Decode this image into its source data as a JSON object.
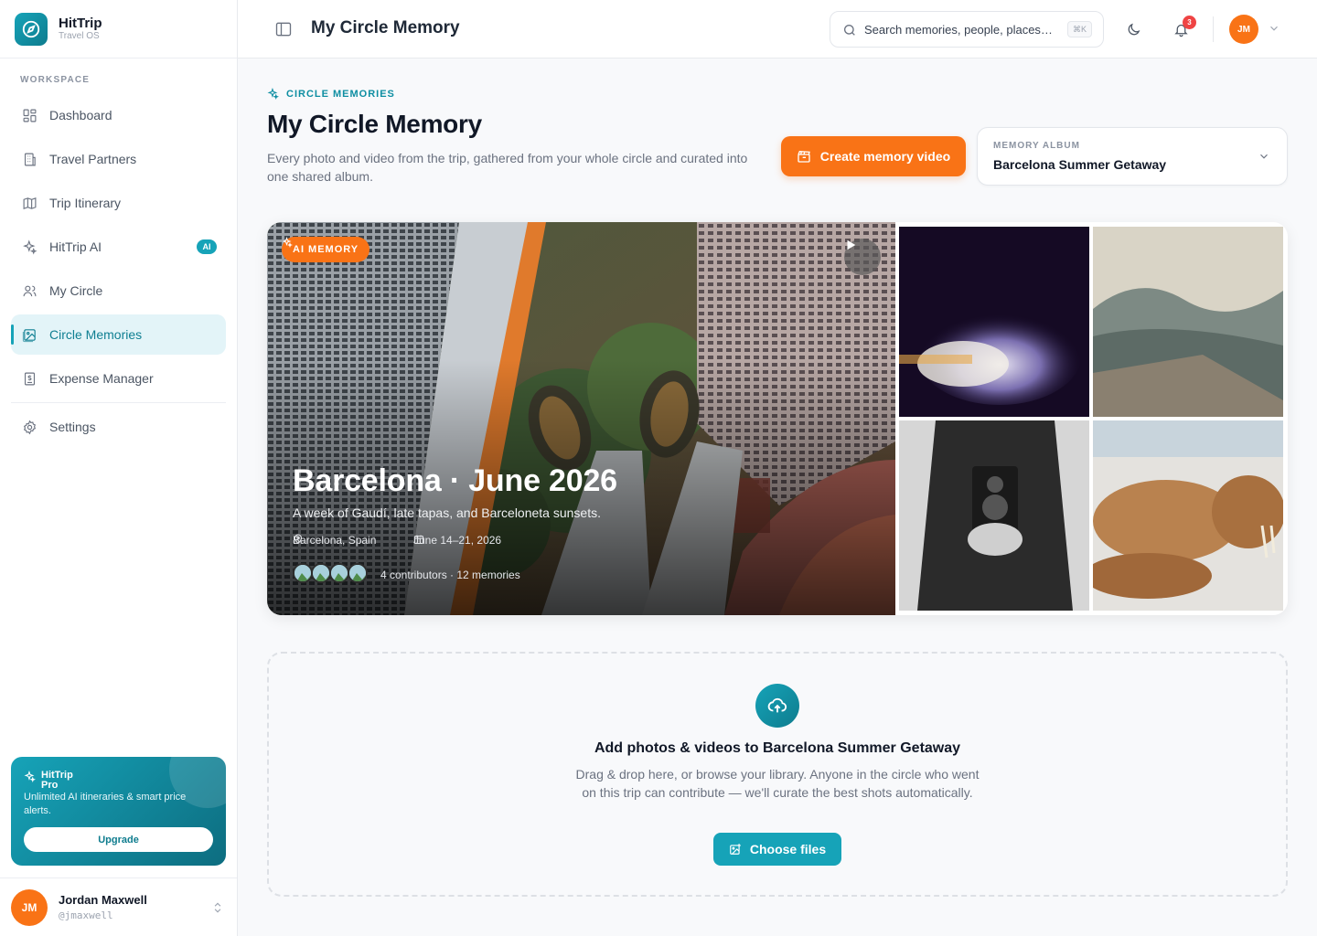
{
  "brand": {
    "name": "HitTrip",
    "tagline": "Travel OS"
  },
  "sidebar": {
    "section_label": "WORKSPACE",
    "items": [
      {
        "label": "Dashboard",
        "icon": "grid-icon"
      },
      {
        "label": "Travel Partners",
        "icon": "building-icon"
      },
      {
        "label": "Trip Itinerary",
        "icon": "map-icon"
      },
      {
        "label": "HitTrip AI",
        "icon": "sparkles-icon",
        "badge": "AI"
      },
      {
        "label": "My Circle",
        "icon": "users-icon"
      },
      {
        "label": "Circle Memories",
        "icon": "images-icon",
        "active": true
      },
      {
        "label": "Expense Manager",
        "icon": "receipt-icon"
      }
    ],
    "settings_label": "Settings",
    "promo": {
      "title": "HitTrip Pro",
      "description": "Unlimited AI itineraries & smart price alerts.",
      "button": "Upgrade"
    },
    "user": {
      "initials": "JM",
      "name": "Jordan Maxwell",
      "handle": "@jmaxwell"
    }
  },
  "topbar": {
    "title": "My Circle Memory",
    "search_placeholder": "Search memories, people, places…",
    "search_shortcut": "⌘K",
    "notifications_count": "3",
    "avatar_initials": "JM"
  },
  "page": {
    "eyebrow": "CIRCLE MEMORIES",
    "title": "My Circle Memory",
    "description": "Every photo and video from the trip, gathered from your whole circle and curated into one shared album.",
    "cta": "Create memory video",
    "album_label": "MEMORY ALBUM",
    "album_value": "Barcelona Summer Getaway"
  },
  "hero": {
    "badge": "AI MEMORY",
    "title": "Barcelona · June 2026",
    "subtitle": "A week of Gaudí, late tapas, and Barceloneta sunsets.",
    "location": "Barcelona, Spain",
    "dates": "June 14–21, 2026",
    "contributors": "4 contributors · 12 memories"
  },
  "dropzone": {
    "title": "Add photos & videos to Barcelona Summer Getaway",
    "description": "Drag & drop here, or browse your library. Anyone in the circle who went on this trip can contribute — we'll curate the best shots automatically.",
    "button": "Choose files"
  },
  "colors": {
    "accent": "#16a3b8",
    "brand_orange": "#f97316",
    "active_bg": "#e3f4f8"
  }
}
